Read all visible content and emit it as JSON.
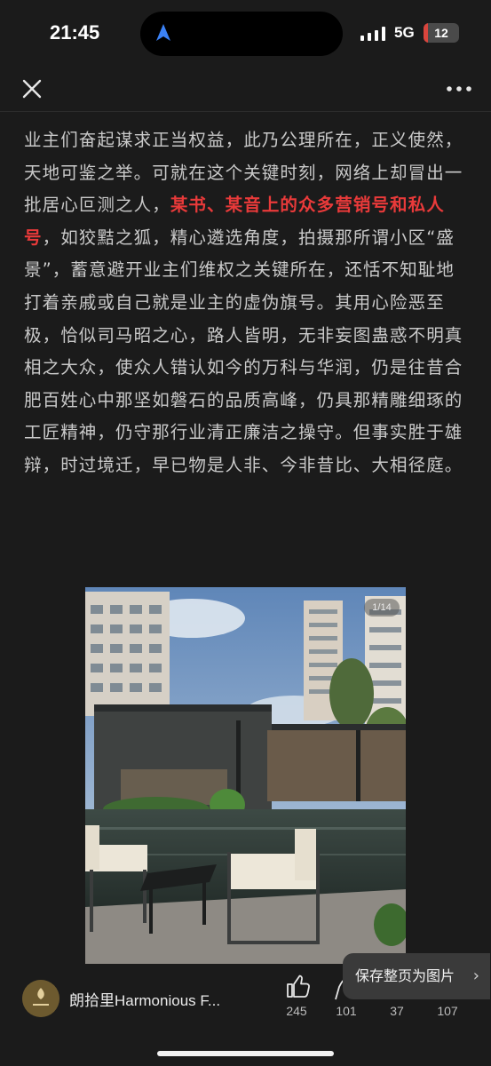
{
  "status": {
    "time": "21:45",
    "network": "5G",
    "battery": "12",
    "battery_level": 0.12
  },
  "article": {
    "lines": [
      "业主们奋起谋求正当权益，此乃公理所在，正义使然，",
      "天地可鉴之举。可就在这个关键时刻，网络上却冒出一",
      "批居心叵测之人，",
      "某书、某音上的众多营销号和私人",
      "号",
      "，如狡黠之狐，精心遴选角度，拍摄那所谓小区“盛",
      "景”，蓄意避开业主们维权之关键所在，还恬不知耻地",
      "打着亲戚或自己就是业主的虚伪旗号。其用心险恶至",
      "极，恰似司马昭之心，路人皆明，无非妄图蛊惑不明真",
      "相之大众，使众人错认如今的万科与华润，仍是往昔合",
      "肥百姓心中那坚如磐石的品质高峰，仍具那精雕细琢的",
      "工匠精神，仍守那行业清正廉洁之操守。但事实胜于雄",
      "辩，时过境迁，早已物是人非、今非昔比、大相径庭。"
    ]
  },
  "photo": {
    "counter": "1/14"
  },
  "bottom": {
    "author": "朗拾里Harmonious F...",
    "likes": "245",
    "comments": "101",
    "favorites": "37",
    "shares": "107",
    "save_label": "保存整页为图片",
    "save_chevron": "›"
  },
  "icons": {
    "close": "close-icon",
    "more": "more-icon",
    "like": "thumbs-up-icon",
    "comment": "comment-icon",
    "location": "location-arrow-icon"
  },
  "colors": {
    "background": "#1b1b1b",
    "text": "#c9c9c9",
    "highlight": "#e93a3a",
    "battery": "#d9453d"
  }
}
